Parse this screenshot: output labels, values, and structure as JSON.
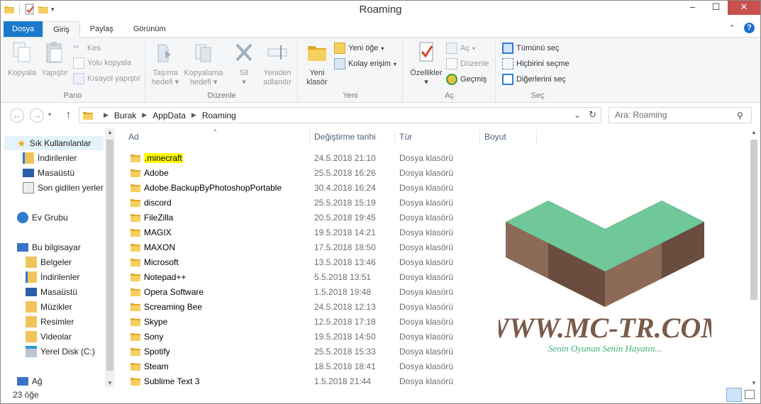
{
  "window": {
    "title": "Roaming",
    "min": "–",
    "max": "☐",
    "close": "✕"
  },
  "tabs": [
    {
      "label": "Dosya"
    },
    {
      "label": "Giriş"
    },
    {
      "label": "Paylaş"
    },
    {
      "label": "Görünüm"
    }
  ],
  "ribbon": {
    "pano": {
      "label": "Pano",
      "kopyala": "Kopyala",
      "yapistir": "Yapıştır",
      "kes": "Kes",
      "yolu_kopyala": "Yolu kopyala",
      "kisayol": "Kısayol yapıştır"
    },
    "duzenle": {
      "label": "Düzenle",
      "tasima_1": "Taşıma",
      "tasima_2": "hedefi",
      "kopyalama_1": "Kopyalama",
      "kopyalama_2": "hedefi",
      "sil": "Sil",
      "yeniden_1": "Yeniden",
      "yeniden_2": "adlandır"
    },
    "yeni": {
      "label": "Yeni",
      "klasor_1": "Yeni",
      "klasor_2": "klasör",
      "yeni_oge": "Yeni öğe",
      "kolay_erisim": "Kolay erişim"
    },
    "ac": {
      "label": "Aç",
      "ozellikler": "Özellikler",
      "ac": "Aç",
      "duzenle": "Düzenle",
      "gecmis": "Geçmiş"
    },
    "sec": {
      "label": "Seç",
      "tumunu": "Tümünü seç",
      "hicbirini": "Hiçbirini seçme",
      "digerlerini": "Diğerlerini seç"
    }
  },
  "breadcrumb": [
    "Burak",
    "AppData",
    "Roaming"
  ],
  "search": {
    "placeholder": "Ara: Roaming"
  },
  "nav": {
    "favorites": "Sık Kullanılanlar",
    "fav_items": [
      "İndirilenler",
      "Masaüstü",
      "Son gidilen yerler"
    ],
    "homegroup": "Ev Grubu",
    "pc": "Bu bilgisayar",
    "pc_items": [
      "Belgeler",
      "İndirilenler",
      "Masaüstü",
      "Müzikler",
      "Resimler",
      "Videolar",
      "Yerel Disk (C:)"
    ],
    "network": "Ağ"
  },
  "columns": {
    "name": "Ad",
    "date": "Değiştirme tarihi",
    "type": "Tür",
    "size": "Boyut"
  },
  "files": [
    {
      "name": ".minecraft",
      "date": "24.5.2018 21:10",
      "type": "Dosya klasörü"
    },
    {
      "name": "Adobe",
      "date": "25.5.2018 16:26",
      "type": "Dosya klasörü"
    },
    {
      "name": "Adobe.BackupByPhotoshopPortable",
      "date": "30.4.2018 16:24",
      "type": "Dosya klasörü"
    },
    {
      "name": "discord",
      "date": "25.5.2018 15:19",
      "type": "Dosya klasörü"
    },
    {
      "name": "FileZilla",
      "date": "20.5.2018 19:45",
      "type": "Dosya klasörü"
    },
    {
      "name": "MAGIX",
      "date": "19.5.2018 14:21",
      "type": "Dosya klasörü"
    },
    {
      "name": "MAXON",
      "date": "17.5.2018 18:50",
      "type": "Dosya klasörü"
    },
    {
      "name": "Microsoft",
      "date": "13.5.2018 13:46",
      "type": "Dosya klasörü"
    },
    {
      "name": "Notepad++",
      "date": "5.5.2018 13:51",
      "type": "Dosya klasörü"
    },
    {
      "name": "Opera Software",
      "date": "1.5.2018 19:48",
      "type": "Dosya klasörü"
    },
    {
      "name": "Screaming Bee",
      "date": "24.5.2018 12:13",
      "type": "Dosya klasörü"
    },
    {
      "name": "Skype",
      "date": "12.5.2018 17:18",
      "type": "Dosya klasörü"
    },
    {
      "name": "Sony",
      "date": "19.5.2018 14:50",
      "type": "Dosya klasörü"
    },
    {
      "name": "Spotify",
      "date": "25.5.2018 15:33",
      "type": "Dosya klasörü"
    },
    {
      "name": "Steam",
      "date": "18.5.2018 18:41",
      "type": "Dosya klasörü"
    },
    {
      "name": "Sublime Text 3",
      "date": "1.5.2018 21:44",
      "type": "Dosya klasörü"
    }
  ],
  "watermark": {
    "site": "WWW.MC-TR.COM",
    "slogan": "Senin Oyunun Senin Hayatın..."
  },
  "status": {
    "count": "23 öğe"
  },
  "colors": {
    "accent": "#1979ca",
    "folder": "#e8b93a",
    "highlight": "#ffff00",
    "grass": "#6fc79a",
    "dirt": "#7a5a4a"
  }
}
